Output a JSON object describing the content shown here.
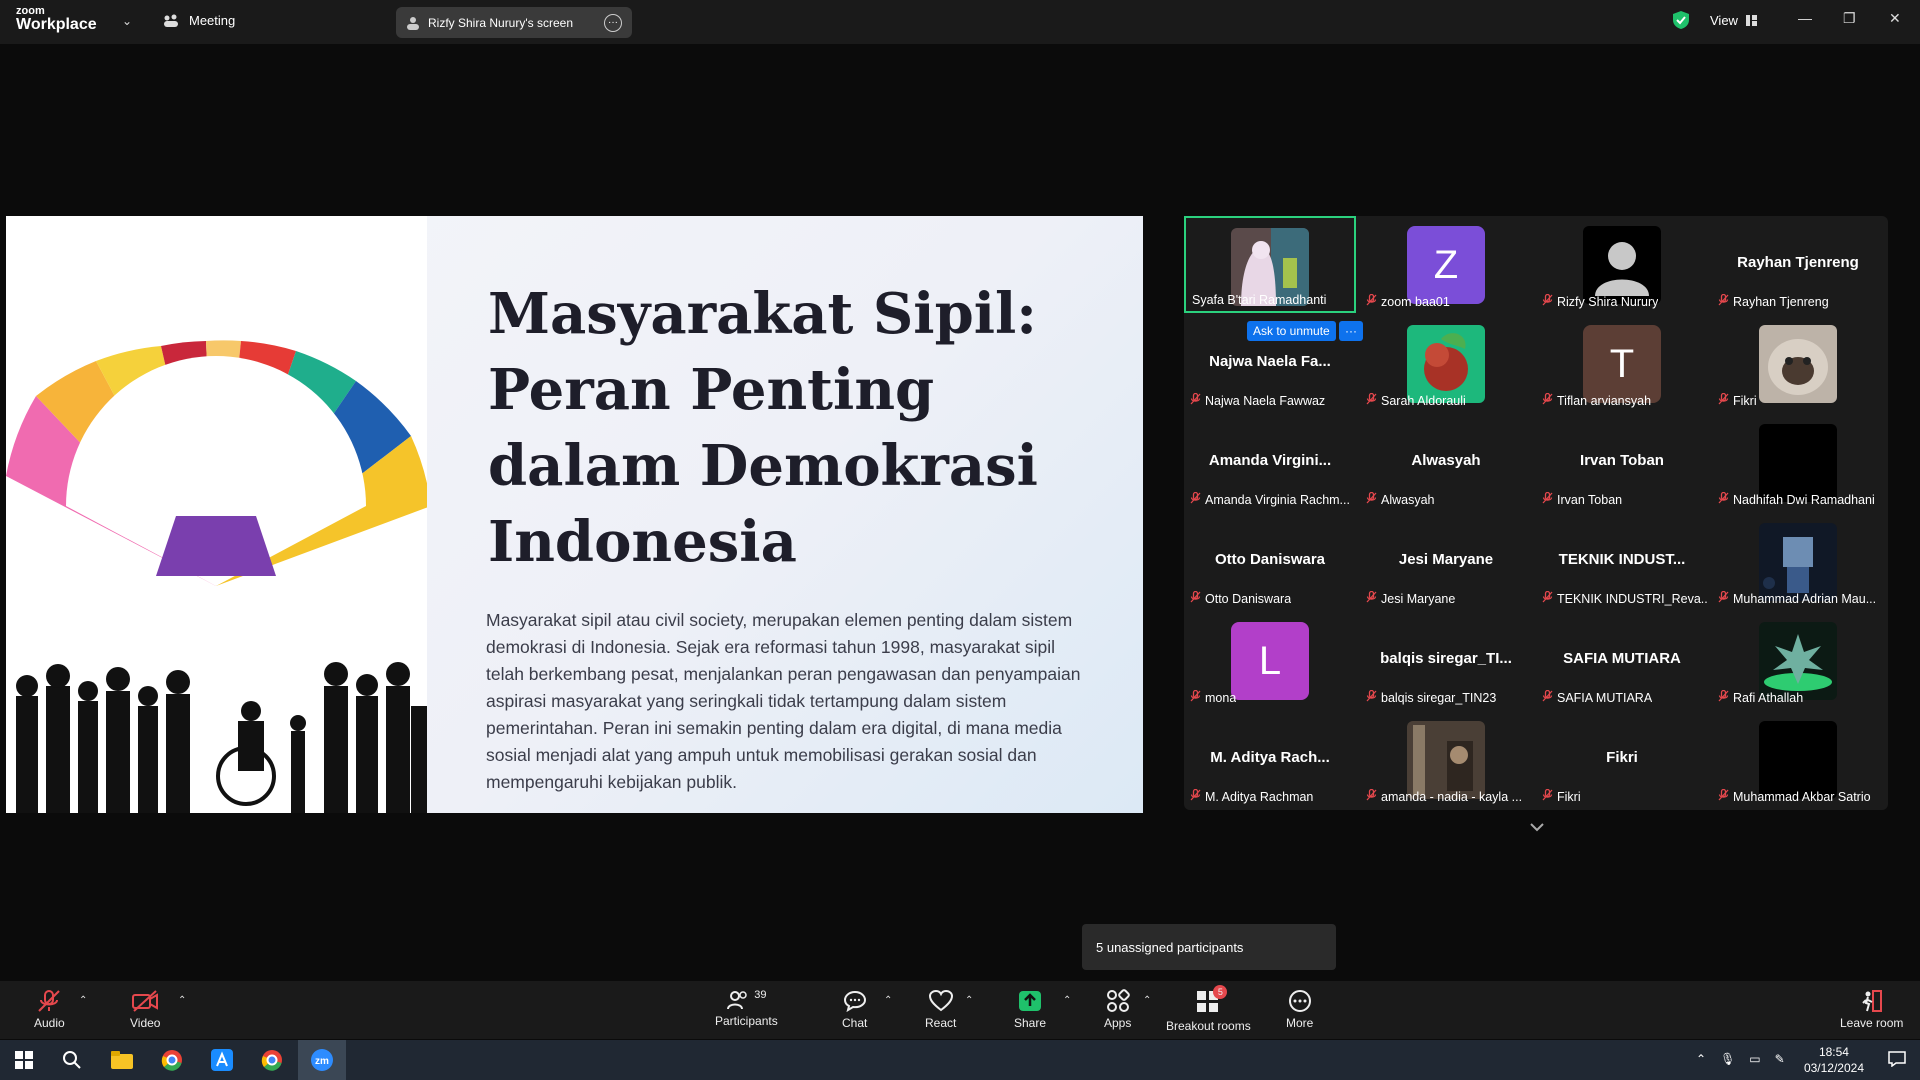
{
  "app": {
    "brand_small": "zoom",
    "brand": "Workplace",
    "meeting_label": "Meeting",
    "screen_label": "Rizfy Shira Nurury's screen",
    "view_label": "View"
  },
  "slide": {
    "title": "Masyarakat Sipil: Peran Penting dalam Demokrasi Indonesia",
    "body": "Masyarakat sipil atau civil society, merupakan elemen penting dalam sistem demokrasi di Indonesia. Sejak era reformasi tahun 1998, masyarakat sipil telah berkembang pesat, menjalankan peran pengawasan dan penyampaian aspirasi masyarakat yang seringkali tidak tertampung dalam sistem pemerintahan. Peran ini semakin penting dalam era digital, di mana media sosial menjadi alat yang ampuh untuk memobilisasi gerakan sosial dan mempengaruhi kebijakan publik."
  },
  "gallery": {
    "ask_unmute": "Ask to unmute",
    "ask_more": "···",
    "tiles": [
      {
        "name": "Syafa B'tari Ramadhanti",
        "display": "",
        "letter": "",
        "kind": "photo-girl",
        "muted": false
      },
      {
        "name": "zoom baa01",
        "display": "",
        "letter": "Z",
        "kind": "letter",
        "color": "#7b4ed8",
        "muted": true
      },
      {
        "name": "Rizfy Shira Nurury",
        "display": "",
        "letter": "",
        "kind": "silhouette",
        "muted": true
      },
      {
        "name": "Rayhan Tjenreng",
        "display": "Rayhan Tjenreng",
        "letter": "",
        "kind": "text",
        "muted": true
      },
      {
        "name": "Najwa Naela Fawwaz",
        "display": "Najwa Naela Fa...",
        "letter": "",
        "kind": "text",
        "muted": true
      },
      {
        "name": "Sarah Aldorauli",
        "display": "",
        "letter": "",
        "kind": "photo-fruit",
        "muted": true
      },
      {
        "name": "Tiflan arviansyah",
        "display": "",
        "letter": "T",
        "kind": "letter",
        "color": "#5c3e35",
        "muted": true
      },
      {
        "name": "Fikri",
        "display": "",
        "letter": "",
        "kind": "photo-cat",
        "muted": true
      },
      {
        "name": "Amanda Virginia Rachm...",
        "display": "Amanda  Virgini...",
        "letter": "",
        "kind": "text",
        "muted": true
      },
      {
        "name": "Alwasyah",
        "display": "Alwasyah",
        "letter": "",
        "kind": "text",
        "muted": true
      },
      {
        "name": "Irvan Toban",
        "display": "Irvan Toban",
        "letter": "",
        "kind": "text",
        "muted": true
      },
      {
        "name": "Nadhifah Dwi Ramadhani",
        "display": "",
        "letter": "",
        "kind": "black",
        "muted": true
      },
      {
        "name": "Otto Daniswara",
        "display": "Otto Daniswara",
        "letter": "",
        "kind": "text",
        "muted": true
      },
      {
        "name": "Jesi Maryane",
        "display": "Jesi Maryane",
        "letter": "",
        "kind": "text",
        "muted": true
      },
      {
        "name": "TEKNIK INDUSTRI_Reva...",
        "display": "TEKNIK  INDUST...",
        "letter": "",
        "kind": "text",
        "muted": true
      },
      {
        "name": "Muhammad Adrian Mau...",
        "display": "",
        "letter": "",
        "kind": "photo-game",
        "muted": true
      },
      {
        "name": "mona",
        "display": "",
        "letter": "L",
        "kind": "letter",
        "color": "#b23fc9",
        "muted": true
      },
      {
        "name": "balqis siregar_TIN23",
        "display": "balqis  siregar_TI...",
        "letter": "",
        "kind": "text",
        "muted": true
      },
      {
        "name": "SAFIA MUTIARA",
        "display": "SAFIA MUTIARA",
        "letter": "",
        "kind": "text",
        "muted": true
      },
      {
        "name": "Rafi Athallah",
        "display": "",
        "letter": "",
        "kind": "photo-spiky",
        "muted": true
      },
      {
        "name": "M. Aditya Rachman",
        "display": "M.  Aditya  Rach...",
        "letter": "",
        "kind": "text",
        "muted": true
      },
      {
        "name": "amanda - nadia - kayla ...",
        "display": "",
        "letter": "",
        "kind": "photo-room",
        "muted": true
      },
      {
        "name": "Fikri",
        "display": "Fikri",
        "letter": "",
        "kind": "text",
        "muted": true
      },
      {
        "name": "Muhammad Akbar Satrio",
        "display": "",
        "letter": "",
        "kind": "black",
        "muted": true
      }
    ]
  },
  "tooltip": "5 unassigned participants",
  "toolbar": {
    "audio": "Audio",
    "video": "Video",
    "participants": "Participants",
    "participants_count": "39",
    "chat": "Chat",
    "react": "React",
    "share": "Share",
    "apps": "Apps",
    "breakout": "Breakout rooms",
    "breakout_badge": "5",
    "more": "More",
    "leave": "Leave room"
  },
  "taskbar": {
    "time": "18:54",
    "date": "03/12/2024"
  },
  "colors": {
    "accent": "#0e72ed",
    "active_border": "#2bd17e",
    "muted_red": "#e5484d",
    "share_green": "#1fc16b"
  }
}
